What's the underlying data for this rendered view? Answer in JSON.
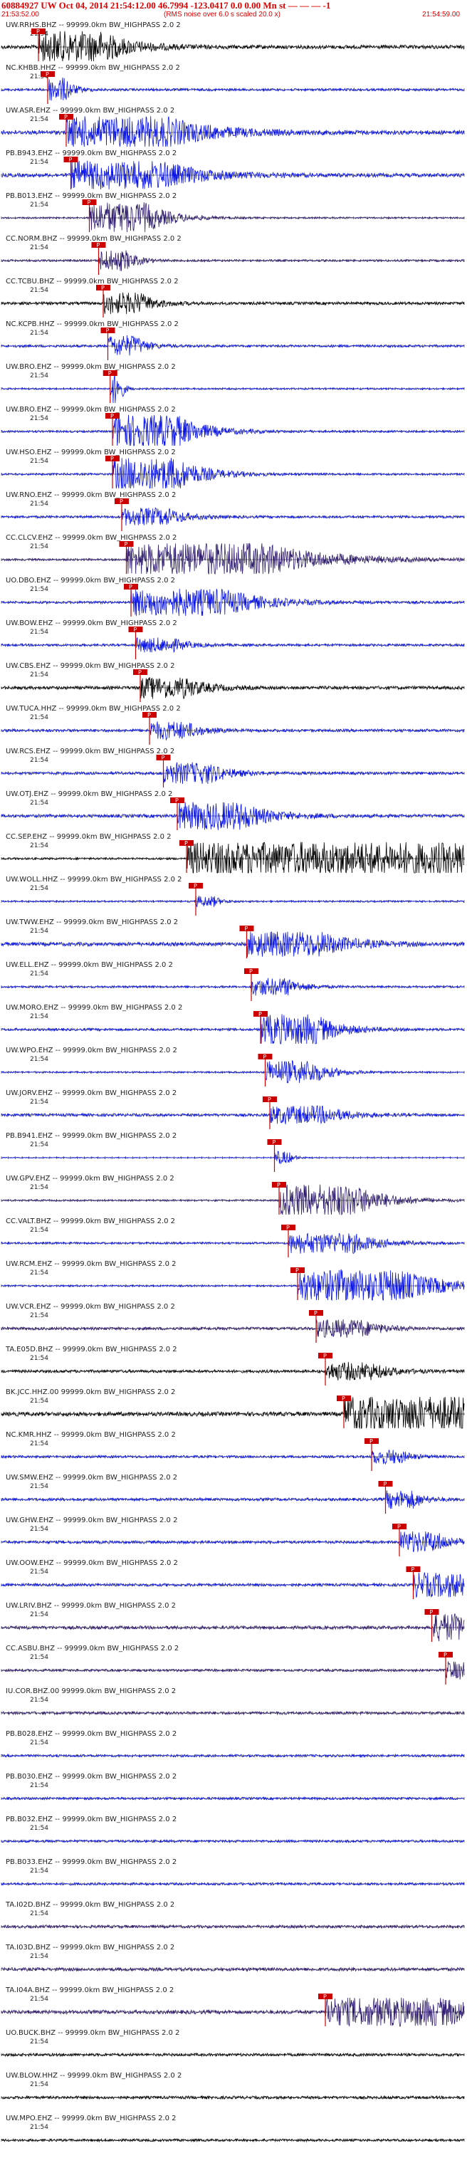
{
  "header": {
    "title": "60884927 UW Oct 04, 2014 21:54:12.00   46.7994 -123.0417  0.0 0.00 Mn st — — — -1",
    "start_time": "21:53:52.00",
    "rms_note": "(RMS noise over 6.0 s scaled 20.0 x)",
    "end_time": "21:54:59.00"
  },
  "tick_label": "21:54",
  "pick_label": "P",
  "colors": {
    "black": "#000000",
    "blue": "#0a14e6",
    "purple": "#2e1a6e",
    "pick": "#cc0000",
    "red": "#cc0000"
  },
  "traces": [
    {
      "label": "UW.RRHS.BHZ -- 99999.0km BW_HIGHPASS 2.0 2",
      "color": "black",
      "noise": 0.45,
      "event_frac": 0.08,
      "burst": 0.9,
      "burst_len": 0.14
    },
    {
      "label": "NC.KHBB.HHZ -- 99999.0km BW_HIGHPASS 2.0 2",
      "color": "blue",
      "noise": 0.3,
      "event_frac": 0.1,
      "burst": 0.7,
      "burst_len": 0.04
    },
    {
      "label": "UW.ASR.EHZ -- 99999.0km BW_HIGHPASS 2.0 2",
      "color": "blue",
      "noise": 0.5,
      "event_frac": 0.14,
      "burst": 0.9,
      "burst_len": 0.22
    },
    {
      "label": "PB.B943.EHZ -- 99999.0km BW_HIGHPASS 2.0 2",
      "color": "blue",
      "noise": 0.45,
      "event_frac": 0.15,
      "burst": 0.8,
      "burst_len": 0.2
    },
    {
      "label": "PB.B013.EHZ -- 99999.0km BW_HIGHPASS 2.0 2",
      "color": "purple",
      "noise": 0.2,
      "event_frac": 0.19,
      "burst": 0.95,
      "burst_len": 0.12
    },
    {
      "label": "CC.NORM.BHZ -- 99999.0km BW_HIGHPASS 2.0 2",
      "color": "purple",
      "noise": 0.25,
      "event_frac": 0.21,
      "burst": 0.6,
      "burst_len": 0.06
    },
    {
      "label": "CC.TCBU.BHZ -- 99999.0km BW_HIGHPASS 2.0 2",
      "color": "black",
      "noise": 0.35,
      "event_frac": 0.22,
      "burst": 0.6,
      "burst_len": 0.08
    },
    {
      "label": "NC.KCPB.HHZ -- 99999.0km BW_HIGHPASS 2.0 2",
      "color": "blue",
      "noise": 0.3,
      "event_frac": 0.23,
      "burst": 0.6,
      "burst_len": 0.06
    },
    {
      "label": "UW.BRO.EHZ -- 99999.0km BW_HIGHPASS 2.0 2",
      "color": "blue",
      "noise": 0.2,
      "event_frac": 0.235,
      "burst": 1.0,
      "burst_len": 0.02
    },
    {
      "label": "UW.BRO.EHZ -- 99999.0km BW_HIGHPASS 2.0 2",
      "color": "blue",
      "noise": 0.25,
      "event_frac": 0.24,
      "burst": 1.0,
      "burst_len": 0.14
    },
    {
      "label": "UW.HSO.EHZ -- 99999.0km BW_HIGHPASS 2.0 2",
      "color": "blue",
      "noise": 0.25,
      "event_frac": 0.24,
      "burst": 1.0,
      "burst_len": 0.14
    },
    {
      "label": "UW.RNO.EHZ -- 99999.0km BW_HIGHPASS 2.0 2",
      "color": "blue",
      "noise": 0.3,
      "event_frac": 0.26,
      "burst": 0.5,
      "burst_len": 0.1
    },
    {
      "label": "CC.CLCV.EHZ -- 99999.0km BW_HIGHPASS 2.0 2",
      "color": "purple",
      "noise": 0.25,
      "event_frac": 0.27,
      "burst": 1.0,
      "burst_len": 0.3
    },
    {
      "label": "UO.DBO.EHZ -- 99999.0km BW_HIGHPASS 2.0 2",
      "color": "blue",
      "noise": 0.3,
      "event_frac": 0.28,
      "burst": 0.8,
      "burst_len": 0.2
    },
    {
      "label": "UW.BOW.EHZ -- 99999.0km BW_HIGHPASS 2.0 2",
      "color": "blue",
      "noise": 0.3,
      "event_frac": 0.29,
      "burst": 0.4,
      "burst_len": 0.08
    },
    {
      "label": "UW.CBS.EHZ -- 99999.0km BW_HIGHPASS 2.0 2",
      "color": "black",
      "noise": 0.4,
      "event_frac": 0.3,
      "burst": 0.6,
      "burst_len": 0.1
    },
    {
      "label": "UW.TUCA.HHZ -- 99999.0km BW_HIGHPASS 2.0 2",
      "color": "blue",
      "noise": 0.35,
      "event_frac": 0.32,
      "burst": 0.5,
      "burst_len": 0.08
    },
    {
      "label": "UW.RCS.EHZ -- 99999.0km BW_HIGHPASS 2.0 2",
      "color": "blue",
      "noise": 0.35,
      "event_frac": 0.35,
      "burst": 0.6,
      "burst_len": 0.1
    },
    {
      "label": "UW.OTJ.EHZ -- 99999.0km BW_HIGHPASS 2.0 2",
      "color": "blue",
      "noise": 0.4,
      "event_frac": 0.38,
      "burst": 0.8,
      "burst_len": 0.14
    },
    {
      "label": "CC.SEP.EHZ -- 99999.0km BW_HIGHPASS 2.0 2",
      "color": "black",
      "noise": 0.25,
      "event_frac": 0.4,
      "burst": 1.0,
      "burst_len": 0.6
    },
    {
      "label": "UW.WOLL.HHZ -- 99999.0km BW_HIGHPASS 2.0 2",
      "color": "blue",
      "noise": 0.2,
      "event_frac": 0.42,
      "burst": 0.3,
      "burst_len": 0.04
    },
    {
      "label": "UW.TWW.EHZ -- 99999.0km BW_HIGHPASS 2.0 2",
      "color": "blue",
      "noise": 0.45,
      "event_frac": 0.53,
      "burst": 0.7,
      "burst_len": 0.16
    },
    {
      "label": "UW.ELL.EHZ -- 99999.0km BW_HIGHPASS 2.0 2",
      "color": "blue",
      "noise": 0.25,
      "event_frac": 0.54,
      "burst": 0.5,
      "burst_len": 0.08
    },
    {
      "label": "UW.MORO.EHZ -- 99999.0km BW_HIGHPASS 2.0 2",
      "color": "blue",
      "noise": 0.3,
      "event_frac": 0.56,
      "burst": 0.9,
      "burst_len": 0.12
    },
    {
      "label": "UW.WPO.EHZ -- 99999.0km BW_HIGHPASS 2.0 2",
      "color": "blue",
      "noise": 0.2,
      "event_frac": 0.57,
      "burst": 0.7,
      "burst_len": 0.1
    },
    {
      "label": "UW.JORV.EHZ -- 99999.0km BW_HIGHPASS 2.0 2",
      "color": "blue",
      "noise": 0.35,
      "event_frac": 0.58,
      "burst": 0.5,
      "burst_len": 0.12
    },
    {
      "label": "PB.B941.EHZ -- 99999.0km BW_HIGHPASS 2.0 2",
      "color": "blue",
      "noise": 0.1,
      "event_frac": 0.59,
      "burst": 0.4,
      "burst_len": 0.03
    },
    {
      "label": "UW.GPV.EHZ -- 99999.0km BW_HIGHPASS 2.0 2",
      "color": "purple",
      "noise": 0.2,
      "event_frac": 0.6,
      "burst": 1.0,
      "burst_len": 0.16
    },
    {
      "label": "CC.VALT.BHZ -- 99999.0km BW_HIGHPASS 2.0 2",
      "color": "blue",
      "noise": 0.25,
      "event_frac": 0.62,
      "burst": 0.6,
      "burst_len": 0.14
    },
    {
      "label": "UW.RCM.EHZ -- 99999.0km BW_HIGHPASS 2.0 2",
      "color": "blue",
      "noise": 0.2,
      "event_frac": 0.64,
      "burst": 1.0,
      "burst_len": 0.22
    },
    {
      "label": "UW.VCR.EHZ -- 99999.0km BW_HIGHPASS 2.0 2",
      "color": "purple",
      "noise": 0.35,
      "event_frac": 0.68,
      "burst": 0.5,
      "burst_len": 0.1
    },
    {
      "label": "TA.E05D.BHZ -- 99999.0km BW_HIGHPASS 2.0 2",
      "color": "black",
      "noise": 0.35,
      "event_frac": 0.7,
      "burst": 0.5,
      "burst_len": 0.1
    },
    {
      "label": "BK.JCC.HHZ.00 99999.0km BW_HIGHPASS 2.0 2",
      "color": "black",
      "noise": 0.5,
      "event_frac": 0.74,
      "burst": 1.0,
      "burst_len": 0.3
    },
    {
      "label": "NC.KMR.HHZ -- 99999.0km BW_HIGHPASS 2.0 2",
      "color": "blue",
      "noise": 0.3,
      "event_frac": 0.8,
      "burst": 0.4,
      "burst_len": 0.06
    },
    {
      "label": "UW.SMW.EHZ -- 99999.0km BW_HIGHPASS 2.0 2",
      "color": "blue",
      "noise": 0.35,
      "event_frac": 0.83,
      "burst": 0.5,
      "burst_len": 0.06
    },
    {
      "label": "UW.GHW.EHZ -- 99999.0km BW_HIGHPASS 2.0 2",
      "color": "blue",
      "noise": 0.35,
      "event_frac": 0.86,
      "burst": 0.6,
      "burst_len": 0.08
    },
    {
      "label": "UW.OOW.EHZ -- 99999.0km BW_HIGHPASS 2.0 2",
      "color": "blue",
      "noise": 0.35,
      "event_frac": 0.89,
      "burst": 0.7,
      "burst_len": 0.1
    },
    {
      "label": "UW.LRIV.BHZ -- 99999.0km BW_HIGHPASS 2.0 2",
      "color": "purple",
      "noise": 0.4,
      "event_frac": 0.93,
      "burst": 0.8,
      "burst_len": 0.06
    },
    {
      "label": "CC.ASBU.BHZ -- 99999.0km BW_HIGHPASS 2.0 2",
      "color": "purple",
      "noise": 0.3,
      "event_frac": 0.96,
      "burst": 0.5,
      "burst_len": 0.04
    },
    {
      "label": "IU.COR.BHZ.00 99999.0km BW_HIGHPASS 2.0 2",
      "color": "purple",
      "noise": 0.35,
      "event_frac": -1,
      "burst": 0,
      "burst_len": 0
    },
    {
      "label": "PB.B028.EHZ -- 99999.0km BW_HIGHPASS 2.0 2",
      "color": "blue",
      "noise": 0.3,
      "event_frac": -1,
      "burst": 0,
      "burst_len": 0
    },
    {
      "label": "PB.B030.EHZ -- 99999.0km BW_HIGHPASS 2.0 2",
      "color": "blue",
      "noise": 0.3,
      "event_frac": -1,
      "burst": 0,
      "burst_len": 0
    },
    {
      "label": "PB.B032.EHZ -- 99999.0km BW_HIGHPASS 2.0 2",
      "color": "blue",
      "noise": 0.3,
      "event_frac": -1,
      "burst": 0,
      "burst_len": 0
    },
    {
      "label": "PB.B033.EHZ -- 99999.0km BW_HIGHPASS 2.0 2",
      "color": "blue",
      "noise": 0.3,
      "event_frac": -1,
      "burst": 0,
      "burst_len": 0
    },
    {
      "label": "TA.I02D.BHZ -- 99999.0km BW_HIGHPASS 2.0 2",
      "color": "purple",
      "noise": 0.35,
      "event_frac": -1,
      "burst": 0,
      "burst_len": 0
    },
    {
      "label": "TA.I03D.BHZ -- 99999.0km BW_HIGHPASS 2.0 2",
      "color": "purple",
      "noise": 0.4,
      "event_frac": -1,
      "burst": 0,
      "burst_len": 0
    },
    {
      "label": "TA.I04A.BHZ -- 99999.0km BW_HIGHPASS 2.0 2",
      "color": "purple",
      "noise": 0.45,
      "event_frac": 0.7,
      "burst": 0.8,
      "burst_len": 0.26
    },
    {
      "label": "UO.BUCK.BHZ -- 99999.0km BW_HIGHPASS 2.0 2",
      "color": "black",
      "noise": 0.35,
      "event_frac": -1,
      "burst": 0,
      "burst_len": 0
    },
    {
      "label": "UW.BLOW.HHZ -- 99999.0km BW_HIGHPASS 2.0 2",
      "color": "black",
      "noise": 0.35,
      "event_frac": -1,
      "burst": 0,
      "burst_len": 0
    },
    {
      "label": "UW.MPO.EHZ -- 99999.0km BW_HIGHPASS 2.0 2",
      "color": "black",
      "noise": 0.3,
      "event_frac": -1,
      "burst": 0,
      "burst_len": 0
    }
  ]
}
